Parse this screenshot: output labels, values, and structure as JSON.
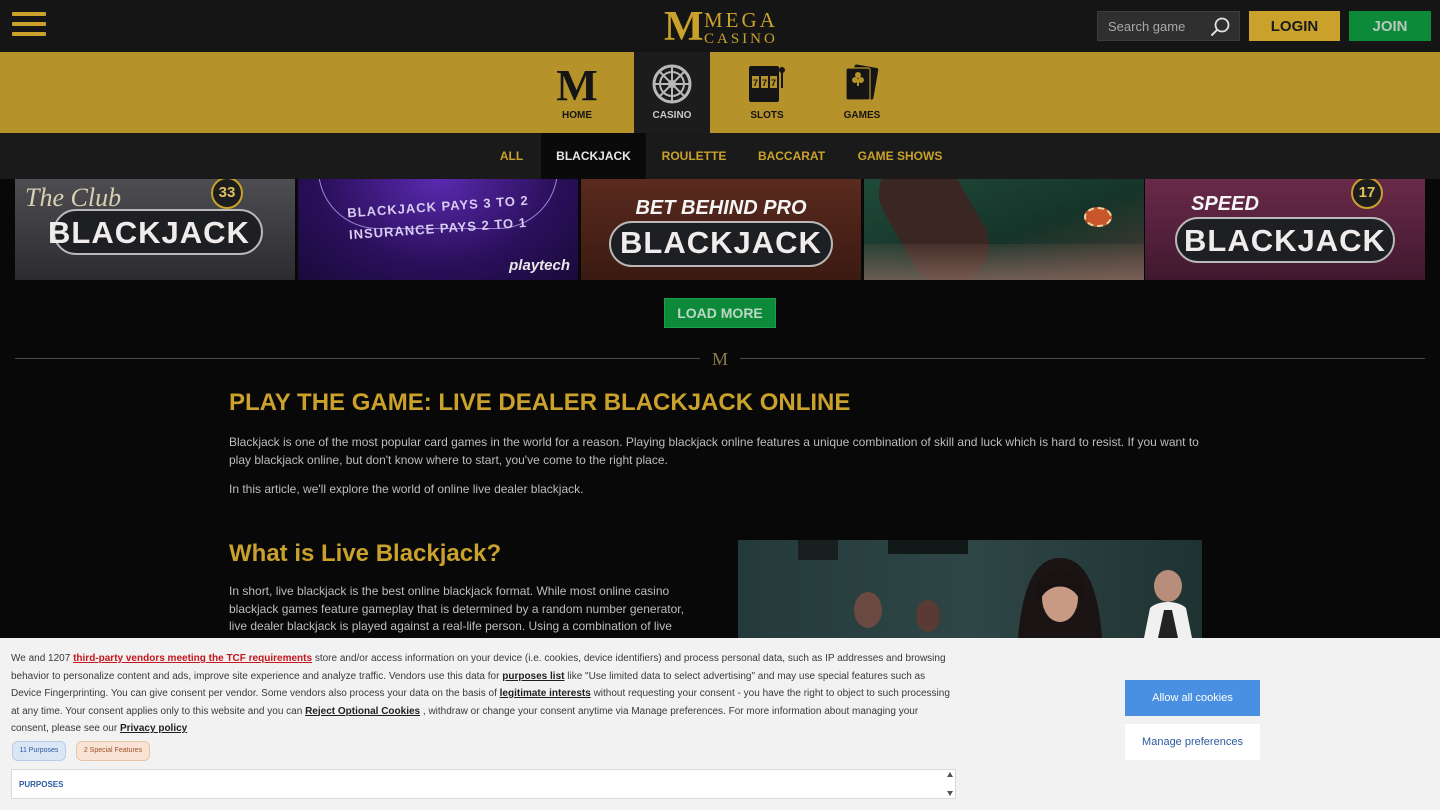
{
  "header": {
    "logo_top": "MEGA",
    "logo_bottom": "CASINO",
    "logo_mark": "M",
    "search_placeholder": "Search game",
    "login_label": "LOGIN",
    "join_label": "JOIN"
  },
  "categories": [
    {
      "label": "HOME",
      "icon": "mega-m-icon",
      "active": false
    },
    {
      "label": "CASINO",
      "icon": "roulette-wheel-icon",
      "active": true
    },
    {
      "label": "SLOTS",
      "icon": "slot-machine-icon",
      "active": false
    },
    {
      "label": "GAMES",
      "icon": "playing-cards-icon",
      "active": false
    }
  ],
  "subtabs": [
    {
      "label": "ALL",
      "active": false
    },
    {
      "label": "BLACKJACK",
      "active": true
    },
    {
      "label": "ROULETTE",
      "active": false
    },
    {
      "label": "BACCARAT",
      "active": false
    },
    {
      "label": "GAME SHOWS",
      "active": false
    }
  ],
  "tiles": [
    {
      "title": "BLACKJACK",
      "script": "The Club",
      "badge": "33"
    },
    {
      "line1": "BLACKJACK PAYS 3 TO 2",
      "line2": "INSURANCE PAYS 2 TO 1",
      "brand": "playtech"
    },
    {
      "title": "BLACKJACK",
      "subtitle": "BET BEHIND PRO"
    },
    {
      "title": ""
    },
    {
      "title": "BLACKJACK",
      "subtitle": "SPEED",
      "badge": "17"
    }
  ],
  "load_more_label": "LOAD MORE",
  "divider_mark": "M",
  "article": {
    "heading": "PLAY THE GAME: LIVE DEALER BLACKJACK ONLINE",
    "intro1": "Blackjack is one of the most popular card games in the world for a reason. Playing blackjack online features a unique combination of skill and luck which is hard to resist. If you want to play blackjack online, but don't know where to start, you've come to the right place.",
    "intro2": "In this article, we'll explore the world of online live dealer blackjack.",
    "subheading": "What is Live Blackjack?",
    "body": "In short, live blackjack is the best online blackjack format. While most online casino blackjack games feature gameplay that is determined by a random number generator, live dealer blackjack is played against a real-life person. Using a combination of live"
  },
  "cookie": {
    "t1": "We and 1207",
    "link_vendors": "third-party vendors meeting the TCF requirements",
    "t2": "store and/or access information on your device (i.e. cookies, device identifiers) and process personal data, such as IP addresses and browsing behavior to personalize content and ads, improve site experience and analyze traffic. Vendors use this data for",
    "link_purposes": "purposes list",
    "t3": "like \"Use limited data to select advertising\" and may use special features such as Device Fingerprinting. You can give consent per vendor. Some vendors also process your data on the basis of",
    "link_legit": "legitimate interests",
    "t4": "without requesting your consent - you have the right to object to such processing at any time. Your consent applies only to this website and you can",
    "link_reject": "Reject Optional Cookies",
    "t5": ", withdraw or change your consent anytime via Manage preferences. For more information about managing your consent, please see our",
    "link_privacy": "Privacy policy",
    "chip_purposes": "11 Purposes",
    "chip_special": "2 Special Features",
    "purposes_heading": "PURPOSES",
    "allow_label": "Allow all cookies",
    "manage_label": "Manage preferences"
  },
  "colors": {
    "gold": "#c9a12b",
    "nav_gold": "#b5922a",
    "green": "#0c8a3a",
    "allow_blue": "#4a90e2"
  }
}
